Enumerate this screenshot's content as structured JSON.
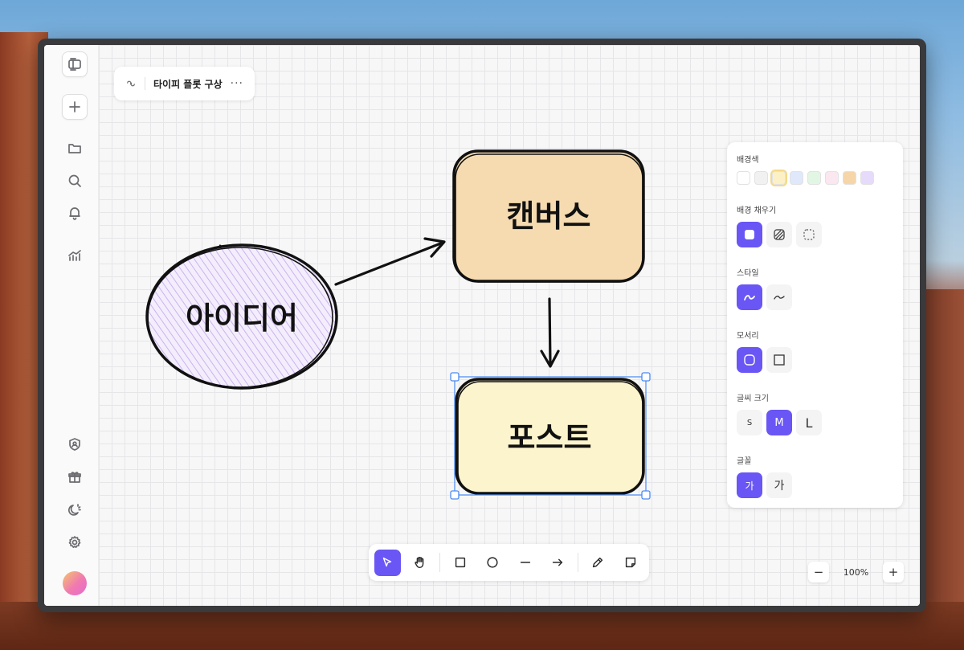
{
  "document": {
    "title": "타이피 플롯 구상",
    "more_label": "···"
  },
  "diagram": {
    "nodes": [
      {
        "id": "idea",
        "label": "아이디어",
        "shape": "ellipse",
        "fill": "#e6dcf7"
      },
      {
        "id": "canvas",
        "label": "캔버스",
        "shape": "rounded-rect",
        "fill": "#f6dbb1"
      },
      {
        "id": "post",
        "label": "포스트",
        "shape": "rounded-rect",
        "fill": "#fcf4cc",
        "selected": true
      }
    ],
    "edges": [
      {
        "from": "idea",
        "to": "canvas"
      },
      {
        "from": "canvas",
        "to": "post"
      }
    ]
  },
  "panel": {
    "background_color_title": "배경색",
    "background_colors": [
      "#ffffff",
      "#f1f1f2",
      "#fcf1c6",
      "#dfe9fb",
      "#e2f6e4",
      "#fbe7ef",
      "#f6d6a8",
      "#e6dbfb"
    ],
    "selected_background": "#fcf1c6",
    "fill_title": "배경 채우기",
    "fill_options": [
      "solid",
      "hatch",
      "none"
    ],
    "style_title": "스타일",
    "style_options": [
      "sketchy",
      "smooth"
    ],
    "corner_title": "모서리",
    "corner_options": [
      "round",
      "sharp"
    ],
    "font_size_title": "글씨 크기",
    "font_sizes": [
      "S",
      "M",
      "L"
    ],
    "selected_font_size": "M",
    "font_title": "글꼴",
    "font_options": [
      "가",
      "가"
    ]
  },
  "toolbar": {
    "tools": [
      "select",
      "hand",
      "rectangle",
      "ellipse",
      "line",
      "arrow",
      "pencil",
      "note"
    ],
    "active_tool": "select"
  },
  "zoom": {
    "value": "100%",
    "minus": "−",
    "plus": "+"
  },
  "colors": {
    "accent": "#6956f5",
    "selection": "#4a8af4"
  }
}
